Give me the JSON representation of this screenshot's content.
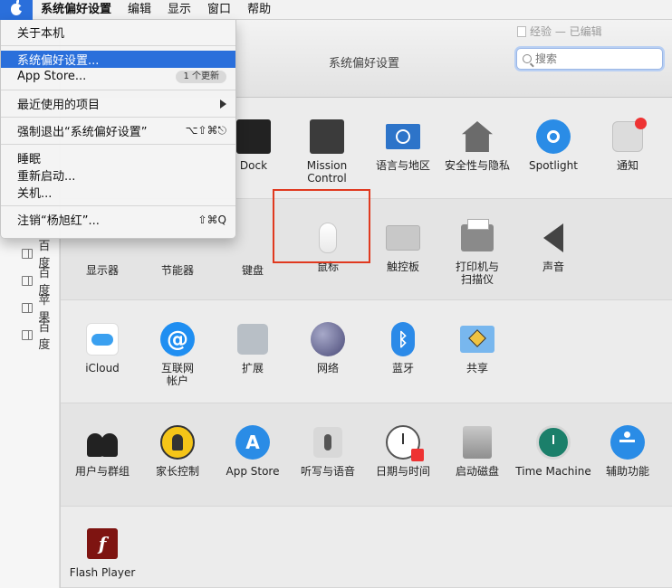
{
  "menubar": {
    "app": "系统偏好设置",
    "items": [
      "编辑",
      "显示",
      "窗口",
      "帮助"
    ]
  },
  "document_title": "经验 — 已编辑",
  "window": {
    "title": "系统偏好设置",
    "search_placeholder": "搜索"
  },
  "sidebar_rows": [
    "百度",
    "百度",
    "苹果",
    "百度"
  ],
  "apple_menu": {
    "about": "关于本机",
    "system_prefs": "系统偏好设置...",
    "app_store": "App Store...",
    "app_store_badge": "1 个更新",
    "recent": "最近使用的项目",
    "force_quit": "强制退出“系统偏好设置”",
    "force_quit_shortcut": "⌥⇧⌘⎋",
    "sleep": "睡眠",
    "restart": "重新启动...",
    "shutdown": "关机...",
    "logout": "注销“杨旭红”...",
    "logout_shortcut": "⇧⌘Q"
  },
  "prefs": {
    "row1": [
      "Dock",
      "Mission\nControl",
      "语言与地区",
      "安全性与隐私",
      "Spotlight",
      "通知"
    ],
    "row2": [
      "显示器",
      "节能器",
      "键盘",
      "鼠标",
      "触控板",
      "打印机与\n扫描仪",
      "声音"
    ],
    "row3": [
      "iCloud",
      "互联网\n帐户",
      "扩展",
      "网络",
      "蓝牙",
      "共享"
    ],
    "row4": [
      "用户与群组",
      "家长控制",
      "App Store",
      "听写与语音",
      "日期与时间",
      "启动磁盘",
      "Time Machine",
      "辅助功能"
    ],
    "row5": [
      "Flash Player"
    ]
  },
  "glyphs": {
    "at": "@",
    "bluetooth": "ᛒ",
    "appstore": "A",
    "flash": "f"
  }
}
